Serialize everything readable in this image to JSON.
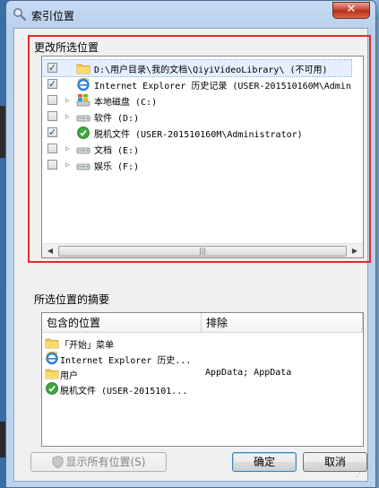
{
  "window": {
    "title": "索引位置",
    "close_glyph": "✕"
  },
  "locations": {
    "group_label": "更改所选位置",
    "items": [
      {
        "label": "D:\\用户目录\\我的文档\\QiyiVideoLibrary\\ (不可用)",
        "checked": true,
        "expandable": false,
        "icon": "folder-icon"
      },
      {
        "label": "Internet Explorer 历史记录 (USER-201510160M\\Admin",
        "checked": true,
        "expandable": false,
        "icon": "ie-icon"
      },
      {
        "label": "本地磁盘 (C:)",
        "checked": false,
        "expandable": true,
        "icon": "system-drive-icon"
      },
      {
        "label": "软件 (D:)",
        "checked": false,
        "expandable": true,
        "icon": "drive-icon"
      },
      {
        "label": "脱机文件 (USER-201510160M\\Administrator)",
        "checked": true,
        "expandable": false,
        "icon": "offline-files-icon"
      },
      {
        "label": "文档 (E:)",
        "checked": false,
        "expandable": true,
        "icon": "drive-icon"
      },
      {
        "label": "娱乐 (F:)",
        "checked": false,
        "expandable": true,
        "icon": "drive-icon"
      }
    ],
    "scroll_left": "◀",
    "scroll_right": "▶",
    "scroll_grip": "|||"
  },
  "summary": {
    "group_label": "所选位置的摘要",
    "col_included": "包含的位置",
    "col_exclude": "排除",
    "rows": [
      {
        "location": "「开始」菜单",
        "exclude": "",
        "icon": "folder-icon"
      },
      {
        "location": "Internet Explorer 历史...",
        "exclude": "",
        "icon": "ie-icon"
      },
      {
        "location": "用户",
        "exclude": "AppData; AppData",
        "icon": "folder-icon"
      },
      {
        "location": "脱机文件 (USER-2015101...",
        "exclude": "",
        "icon": "offline-files-icon"
      }
    ]
  },
  "buttons": {
    "show_all": "显示所有位置(S)",
    "ok": "确定",
    "cancel": "取消"
  },
  "colors": {
    "highlight_frame": "#e02b2b",
    "check": "#1d4f91"
  }
}
